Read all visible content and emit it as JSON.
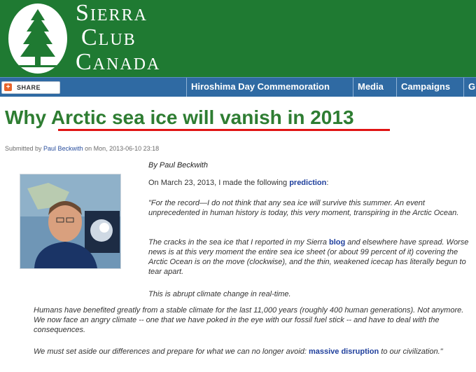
{
  "brand": {
    "line1": "Sierra",
    "line2": "Club",
    "line3": "Canada"
  },
  "share": {
    "label": "SHARE",
    "icon": "plus-icon"
  },
  "nav": {
    "items": [
      "Hiroshima Day Commemoration",
      "Media",
      "Campaigns",
      "G"
    ]
  },
  "colors": {
    "header": "#1f7a32",
    "nav": "#2f6aa3",
    "title": "#2e7d32",
    "underline": "#e01414",
    "link": "#1f3f9c"
  },
  "article": {
    "title": "Why Arctic sea ice will vanish in 2013",
    "submitted_prefix": "Submitted by",
    "author": "Paul Beckwith",
    "submitted_suffix": "on Mon, 2013-06-10 23:18",
    "byline": "By Paul Beckwith",
    "p1_pre": "On March 23, 2013, I made the following",
    "p1_link": "prediction",
    "p1_post": ":",
    "quote1": "\"For the record—I do not think that any sea ice will survive this summer. An event unprecedented in human history is today, this very moment, transpiring in the Arctic Ocean.",
    "quote2_pre": "The cracks in the sea ice that I reported in my Sierra",
    "quote2_link": "blog",
    "quote2_post": "and elsewhere have spread. Worse news is at this very moment the entire sea ice sheet (or about 99 percent of it) covering the Arctic Ocean is on the move (clockwise), and the thin, weakened icecap has literally begun to tear apart.",
    "quote3": "This is abrupt climate change in real-time.",
    "quote4": "Humans have benefited greatly from a stable climate for the last 11,000 years (roughly 400 human generations). Not anymore. We now face an angry climate -- one that we have poked in the eye with our fossil fuel stick -- and have to deal with the consequences.",
    "quote5_pre": "We must set aside our differences and prepare for what we can no longer avoid:",
    "quote5_link": "massive disruption",
    "quote5_post": "to our civilization.\""
  }
}
